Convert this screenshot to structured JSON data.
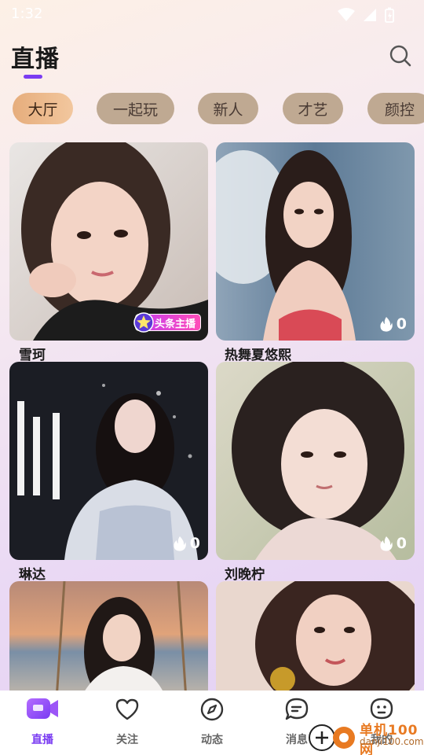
{
  "status": {
    "time": "1:32"
  },
  "header": {
    "title": "直播"
  },
  "tabs": [
    {
      "label": "大厅",
      "active": true
    },
    {
      "label": "一起玩",
      "active": false
    },
    {
      "label": "新人",
      "active": false
    },
    {
      "label": "才艺",
      "active": false
    },
    {
      "label": "颜控",
      "active": false
    }
  ],
  "cards": [
    {
      "name": "雪珂",
      "badge": "头条主播"
    },
    {
      "name": "热舞夏悠熙",
      "heat": "0"
    },
    {
      "name": "琳达",
      "heat": "0"
    },
    {
      "name": "刘晚柠",
      "heat": "0"
    },
    {
      "name": ""
    },
    {
      "name": ""
    }
  ],
  "nav": [
    {
      "label": "直播",
      "icon": "live-video-icon",
      "active": true
    },
    {
      "label": "关注",
      "icon": "heart-icon"
    },
    {
      "label": "动态",
      "icon": "compass-icon"
    },
    {
      "label": "消息",
      "icon": "chat-bubble-icon"
    },
    {
      "label": "我的",
      "icon": "face-icon"
    }
  ],
  "watermark": {
    "brand": "单机100网",
    "url": "danji100.com"
  },
  "colors": {
    "accent": "#7a3cf2",
    "tab_active": "#e6ad7c",
    "tab_inactive": "#bfa992",
    "badge": "#d23ce0"
  }
}
